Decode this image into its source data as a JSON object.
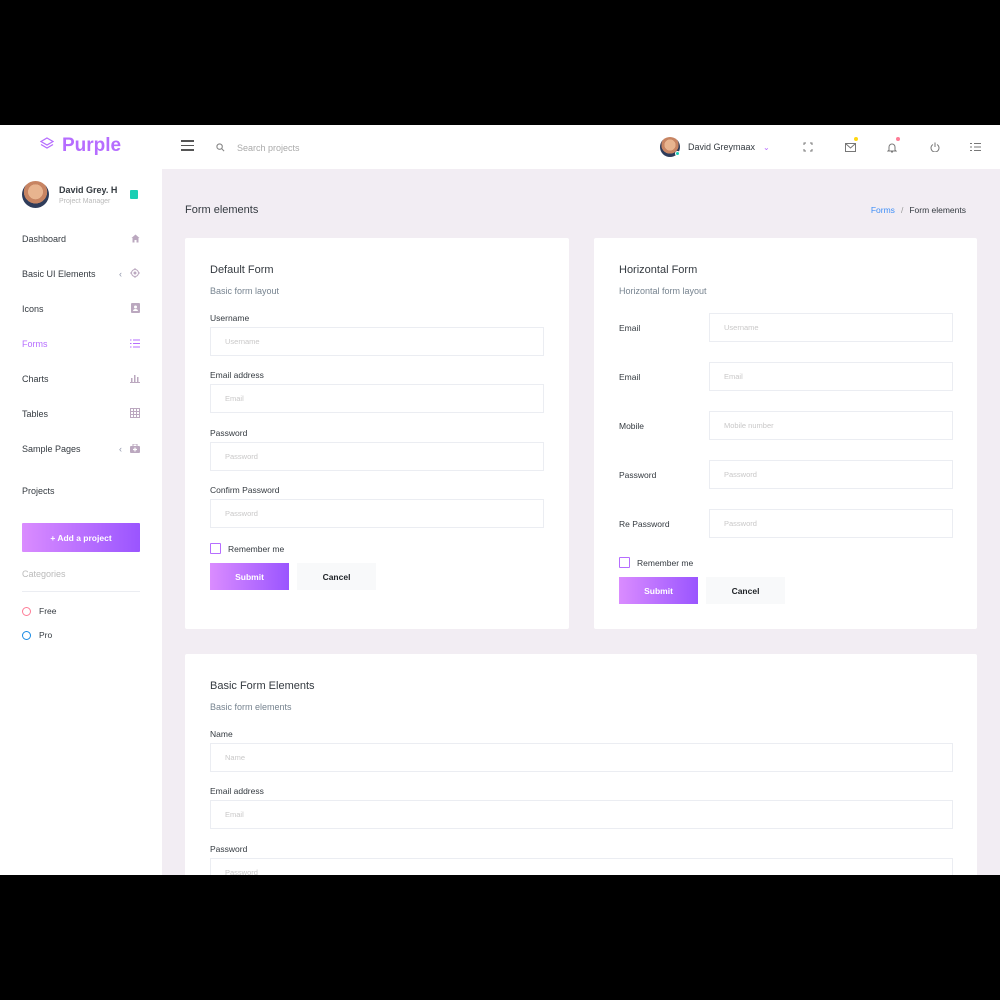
{
  "brand": {
    "name": "Purple"
  },
  "search": {
    "placeholder": "Search projects"
  },
  "navbar": {
    "user_name": "David Greymaax"
  },
  "colors": {
    "accent": "#b66dff",
    "teal": "#1bcfb4",
    "red": "#fe7c96",
    "blue": "#198ae3",
    "link": "#3e8ef7"
  },
  "sidebar": {
    "profile": {
      "name": "David Grey. H",
      "role": "Project Manager"
    },
    "items": [
      {
        "label": "Dashboard",
        "icon": "home-icon"
      },
      {
        "label": "Basic UI Elements",
        "icon": "crosshairs-icon"
      },
      {
        "label": "Icons",
        "icon": "contacts-icon"
      },
      {
        "label": "Forms",
        "icon": "format-list-icon"
      },
      {
        "label": "Charts",
        "icon": "chart-bar-icon"
      },
      {
        "label": "Tables",
        "icon": "table-icon"
      },
      {
        "label": "Sample Pages",
        "icon": "medical-bag-icon"
      }
    ],
    "projects_title": "Projects",
    "add_project": "+ Add a project",
    "categories_title": "Categories",
    "categories": [
      {
        "label": "Free"
      },
      {
        "label": "Pro"
      }
    ]
  },
  "page": {
    "title": "Form elements",
    "breadcrumb": {
      "link": "Forms",
      "sep": "/",
      "current": "Form elements"
    }
  },
  "default_form": {
    "title": "Default Form",
    "description": "Basic form layout",
    "fields": [
      {
        "label": "Username",
        "placeholder": "Username"
      },
      {
        "label": "Email address",
        "placeholder": "Email"
      },
      {
        "label": "Password",
        "placeholder": "Password"
      },
      {
        "label": "Confirm Password",
        "placeholder": "Password"
      }
    ],
    "remember": "Remember me",
    "submit": "Submit",
    "cancel": "Cancel"
  },
  "horizontal_form": {
    "title": "Horizontal Form",
    "description": "Horizontal form layout",
    "fields": [
      {
        "label": "Email",
        "placeholder": "Username"
      },
      {
        "label": "Email",
        "placeholder": "Email"
      },
      {
        "label": "Mobile",
        "placeholder": "Mobile number"
      },
      {
        "label": "Password",
        "placeholder": "Password"
      },
      {
        "label": "Re Password",
        "placeholder": "Password"
      }
    ],
    "remember": "Remember me",
    "submit": "Submit",
    "cancel": "Cancel"
  },
  "basic_elements": {
    "title": "Basic Form Elements",
    "description": "Basic form elements",
    "fields": [
      {
        "label": "Name",
        "placeholder": "Name"
      },
      {
        "label": "Email address",
        "placeholder": "Email"
      },
      {
        "label": "Password",
        "placeholder": "Password"
      }
    ]
  }
}
